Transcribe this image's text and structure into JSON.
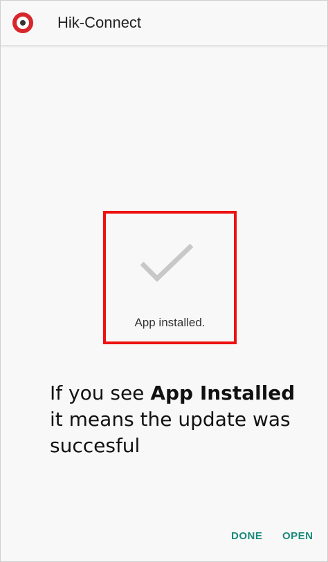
{
  "app": {
    "title": "Hik-Connect",
    "icon": "hik-connect-app-icon"
  },
  "status": {
    "icon": "checkmark-icon",
    "text": "App installed."
  },
  "caption": {
    "part1": "If you see ",
    "bold": "App Installed",
    "part2": " it means the update was succesful"
  },
  "actions": {
    "done_label": "DONE",
    "open_label": "OPEN"
  },
  "colors": {
    "highlight_border": "#ee1111",
    "accent_button": "#19897a",
    "app_icon_red": "#d6272d",
    "checkmark_gray": "#c8c8c8"
  }
}
